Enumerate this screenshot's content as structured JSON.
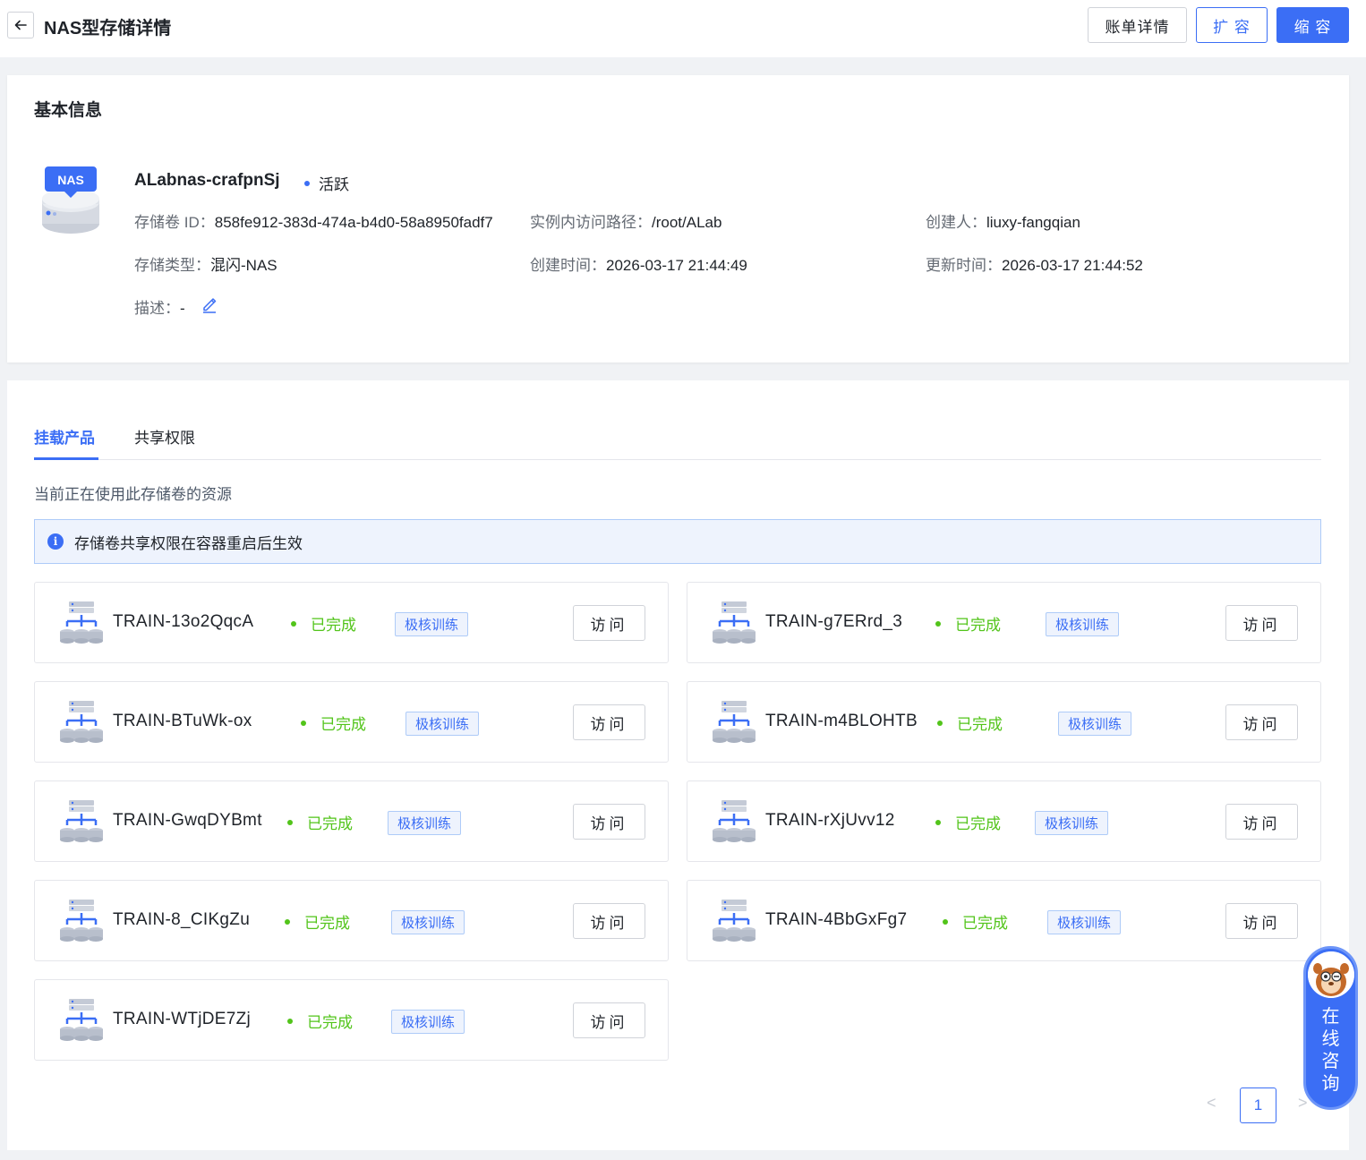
{
  "header": {
    "title": "NAS型存储详情",
    "bill_label": "账单详情",
    "expand_label": "扩 容",
    "shrink_label": "缩 容"
  },
  "basic": {
    "section_title": "基本信息",
    "icon_label": "NAS",
    "name": "ALabnas-crafpnSj",
    "status": "活跃",
    "volume_id_key": "存储卷 ID：",
    "volume_id": "858fe912-383d-474a-b4d0-58a8950fadf7",
    "access_path_key": "实例内访问路径：",
    "access_path": "/root/ALab",
    "creator_key": "创建人：",
    "creator": "liuxy-fangqian",
    "type_key": "存储类型：",
    "type": "混闪-NAS",
    "created_key": "创建时间：",
    "created": "2026-03-17 21:44:49",
    "updated_key": "更新时间：",
    "updated": "2026-03-17 21:44:52",
    "desc_key": "描述：",
    "desc": "-"
  },
  "tabs": [
    {
      "label": "挂载产品",
      "active": true
    },
    {
      "label": "共享权限",
      "active": false
    }
  ],
  "mount": {
    "description": "当前正在使用此存储卷的资源",
    "alert": "存储卷共享权限在容器重启后生效",
    "items": [
      {
        "name": "TRAIN-13o2QqcA",
        "status": "已完成",
        "tag": "极核训练",
        "action": "访问"
      },
      {
        "name": "TRAIN-g7ERrd_3",
        "status": "已完成",
        "tag": "极核训练",
        "action": "访问"
      },
      {
        "name": "TRAIN-BTuWk-ox",
        "status": "已完成",
        "tag": "极核训练",
        "action": "访问"
      },
      {
        "name": "TRAIN-m4BLOHTB",
        "status": "已完成",
        "tag": "极核训练",
        "action": "访问"
      },
      {
        "name": "TRAIN-GwqDYBmt",
        "status": "已完成",
        "tag": "极核训练",
        "action": "访问"
      },
      {
        "name": "TRAIN-rXjUvv12",
        "status": "已完成",
        "tag": "极核训练",
        "action": "访问"
      },
      {
        "name": "TRAIN-8_CIKgZu",
        "status": "已完成",
        "tag": "极核训练",
        "action": "访问"
      },
      {
        "name": "TRAIN-4BbGxFg7",
        "status": "已完成",
        "tag": "极核训练",
        "action": "访问"
      },
      {
        "name": "TRAIN-WTjDE7Zj",
        "status": "已完成",
        "tag": "极核训练",
        "action": "访问"
      }
    ]
  },
  "pagination": {
    "current": "1",
    "prev_icon": "chevron-left-icon",
    "next_icon": "chevron-right-icon"
  },
  "consult": {
    "label": "在线咨询"
  },
  "colors": {
    "primary": "#3b6ef5",
    "success": "#52c41a",
    "text": "#1f2329",
    "muted": "#646a73"
  }
}
